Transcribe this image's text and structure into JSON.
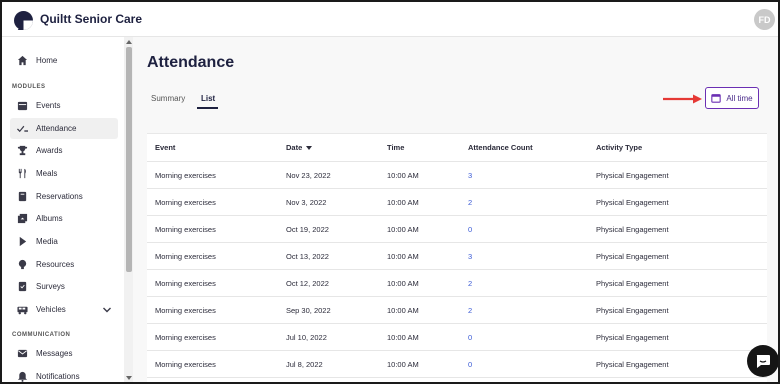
{
  "app": {
    "brand": "Quiltt Senior Care",
    "avatar_initials": "FD"
  },
  "sidebar": {
    "home": "Home",
    "modules_label": "MODULES",
    "items": [
      {
        "label": "Events",
        "icon": "calendar-icon"
      },
      {
        "label": "Attendance",
        "icon": "check-list-icon",
        "active": true
      },
      {
        "label": "Awards",
        "icon": "trophy-icon"
      },
      {
        "label": "Meals",
        "icon": "utensils-icon"
      },
      {
        "label": "Reservations",
        "icon": "book-icon"
      },
      {
        "label": "Albums",
        "icon": "photo-album-icon"
      },
      {
        "label": "Media",
        "icon": "play-icon"
      },
      {
        "label": "Resources",
        "icon": "bulb-icon"
      },
      {
        "label": "Surveys",
        "icon": "survey-icon"
      },
      {
        "label": "Vehicles",
        "icon": "bus-icon",
        "expandable": true
      }
    ],
    "communication_label": "COMMUNICATION",
    "comm_items": [
      {
        "label": "Messages",
        "icon": "message-icon"
      },
      {
        "label": "Notifications",
        "icon": "bell-icon"
      }
    ]
  },
  "main": {
    "title": "Attendance",
    "tabs": [
      {
        "label": "Summary",
        "active": false
      },
      {
        "label": "List",
        "active": true
      }
    ],
    "filter_button": "All time",
    "table": {
      "columns": [
        "Event",
        "Date",
        "Time",
        "Attendance Count",
        "Activity Type"
      ],
      "rows": [
        [
          "Morning exercises",
          "Nov 23, 2022",
          "10:00 AM",
          "3",
          "Physical Engagement"
        ],
        [
          "Morning exercises",
          "Nov 3, 2022",
          "10:00 AM",
          "2",
          "Physical Engagement"
        ],
        [
          "Morning exercises",
          "Oct 19, 2022",
          "10:00 AM",
          "0",
          "Physical Engagement"
        ],
        [
          "Morning exercises",
          "Oct 13, 2022",
          "10:00 AM",
          "3",
          "Physical Engagement"
        ],
        [
          "Morning exercises",
          "Oct 12, 2022",
          "10:00 AM",
          "2",
          "Physical Engagement"
        ],
        [
          "Morning exercises",
          "Sep 30, 2022",
          "10:00 AM",
          "2",
          "Physical Engagement"
        ],
        [
          "Morning exercises",
          "Jul 10, 2022",
          "10:00 AM",
          "0",
          "Physical Engagement"
        ],
        [
          "Morning exercises",
          "Jul 8, 2022",
          "10:00 AM",
          "0",
          "Physical Engagement"
        ]
      ]
    }
  },
  "colors": {
    "brand_navy": "#1e2140",
    "accent_purple": "#6b2fb3",
    "link_blue": "#3b5bd6",
    "annotation_red": "#e53935"
  }
}
